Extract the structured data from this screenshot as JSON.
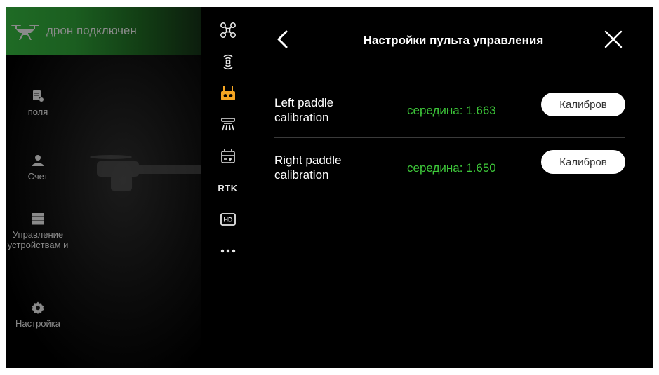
{
  "left_panel": {
    "status_text": "дрон подключен",
    "menu": [
      {
        "label": "поля",
        "icon": "fields-doc-icon"
      },
      {
        "label": "Счет",
        "icon": "user-icon"
      },
      {
        "label": "Управление устройствам и",
        "icon": "server-icon"
      },
      {
        "label": "Настройка",
        "icon": "gear-icon"
      }
    ]
  },
  "icon_strip": {
    "items": [
      {
        "name": "drone-settings-icon",
        "active": false
      },
      {
        "name": "radar-signal-icon",
        "active": false
      },
      {
        "name": "remote-controller-icon",
        "active": true
      },
      {
        "name": "spray-nozzle-icon",
        "active": false
      },
      {
        "name": "battery-icon",
        "active": false
      },
      {
        "name": "rtk",
        "label": "RTK",
        "active": false
      },
      {
        "name": "hd-video-icon",
        "label": "HD",
        "active": false
      },
      {
        "name": "more-icon",
        "active": false
      }
    ],
    "active_color": "#f5a623"
  },
  "settings": {
    "title": "Настройки пульта управления",
    "rows": [
      {
        "label": "Left paddle calibration",
        "value": "середина: 1.663",
        "button": "Калибров"
      },
      {
        "label": "Right paddle calibration",
        "value": "середина: 1.650",
        "button": "Калибров"
      }
    ]
  },
  "colors": {
    "accent_green": "#3ec93a",
    "status_green": "#1f6b25",
    "active_orange": "#f5a623"
  }
}
